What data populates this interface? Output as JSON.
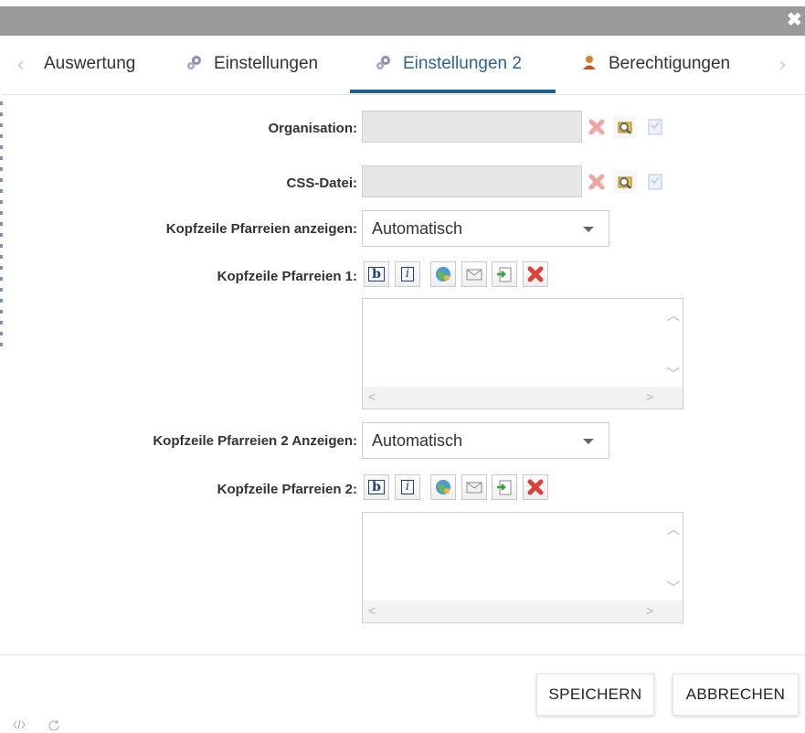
{
  "window": {
    "close_glyph": "✖"
  },
  "tabs": {
    "prev_arrow": "‹",
    "next_arrow": "›",
    "items": [
      {
        "label": "Auswertung",
        "icon": "none"
      },
      {
        "label": "Einstellungen",
        "icon": "gears-icon"
      },
      {
        "label": "Einstellungen 2",
        "icon": "gears-icon",
        "active": true
      },
      {
        "label": "Berechtigungen",
        "icon": "user-icon"
      }
    ]
  },
  "form": {
    "organisation": {
      "label": "Organisation:",
      "value": ""
    },
    "css_datei": {
      "label": "CSS-Datei:",
      "value": ""
    },
    "kopfzeile_anzeigen_1": {
      "label": "Kopfzeile Pfarreien anzeigen:",
      "value": "Automatisch"
    },
    "kopfzeile_1": {
      "label": "Kopfzeile Pfarreien 1:",
      "value": ""
    },
    "kopfzeile_anzeigen_2": {
      "label": "Kopfzeile Pfarreien 2 Anzeigen:",
      "value": "Automatisch"
    },
    "kopfzeile_2": {
      "label": "Kopfzeile Pfarreien 2:",
      "value": ""
    },
    "format_bold_glyph": "b",
    "format_italic_glyph": "i"
  },
  "buttons": {
    "save": "SPEICHERN",
    "cancel": "ABBRECHEN"
  },
  "colors": {
    "title_bar": "#9a9a9a",
    "active_tab": "#2a6496",
    "active_underline": "#1f5f93",
    "delete_red": "#e0403a",
    "readonly_field": "#e6e6e6"
  }
}
